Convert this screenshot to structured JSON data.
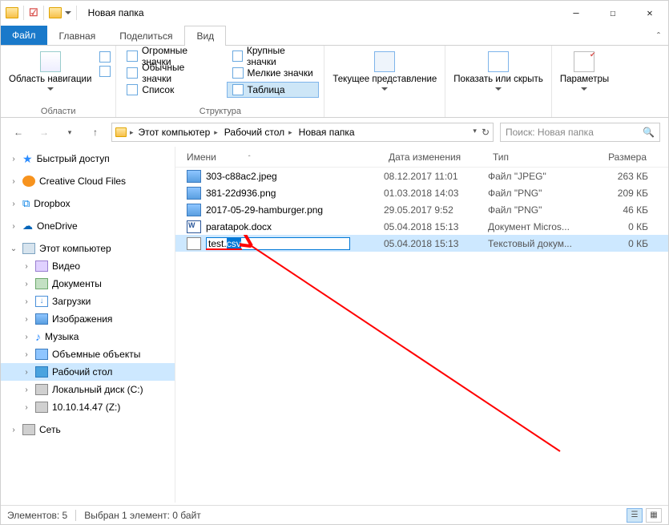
{
  "titlebar": {
    "title": "Новая папка"
  },
  "winbuttons": {
    "min": "—",
    "max": "☐",
    "close": "✕"
  },
  "tabs": {
    "file": "Файл",
    "home": "Главная",
    "share": "Поделиться",
    "view": "Вид"
  },
  "ribbon": {
    "panes_group": "Области",
    "layout_group": "Структура",
    "nav_pane": "Область навигации",
    "views": {
      "huge": "Огромные значки",
      "large": "Крупные значки",
      "normal": "Обычные значки",
      "small": "Мелкие значки",
      "list": "Список",
      "details": "Таблица"
    },
    "current_view": "Текущее представление",
    "show_hide": "Показать или скрыть",
    "options": "Параметры"
  },
  "breadcrumbs": {
    "pc": "Этот компьютер",
    "desk": "Рабочий стол",
    "folder": "Новая папка"
  },
  "search": {
    "placeholder": "Поиск: Новая папка"
  },
  "columns": {
    "name": "Имени",
    "date": "Дата изменения",
    "type": "Тип",
    "size": "Размера"
  },
  "files": [
    {
      "name": "303-c88ac2.jpeg",
      "date": "08.12.2017 11:01",
      "type": "Файл \"JPEG\"",
      "size": "263 КБ",
      "icon": "ic-img"
    },
    {
      "name": "381-22d936.png",
      "date": "01.03.2018 14:03",
      "type": "Файл \"PNG\"",
      "size": "209 КБ",
      "icon": "ic-png"
    },
    {
      "name": "2017-05-29-hamburger.png",
      "date": "29.05.2017 9:52",
      "type": "Файл \"PNG\"",
      "size": "46 КБ",
      "icon": "ic-png"
    },
    {
      "name": "paratapok.docx",
      "date": "05.04.2018 15:13",
      "type": "Документ Micros...",
      "size": "0 КБ",
      "icon": "ic-doc"
    },
    {
      "name_base": "test.",
      "name_sel": "csv",
      "date": "05.04.2018 15:13",
      "type": "Текстовый докум...",
      "size": "0 КБ",
      "icon": "ic-txt",
      "editing": true
    }
  ],
  "nav": {
    "quick": "Быстрый доступ",
    "ccf": "Creative Cloud Files",
    "dropbox": "Dropbox",
    "onedrive": "OneDrive",
    "pc": "Этот компьютер",
    "video": "Видео",
    "docs": "Документы",
    "downloads": "Загрузки",
    "images": "Изображения",
    "music": "Музыка",
    "objects3d": "Объемные объекты",
    "desktop": "Рабочий стол",
    "disk_c": "Локальный диск (C:)",
    "disk_z": "10.10.14.47 (Z:)",
    "network": "Сеть"
  },
  "status": {
    "items": "Элементов: 5",
    "selected": "Выбран 1 элемент: 0 байт"
  }
}
